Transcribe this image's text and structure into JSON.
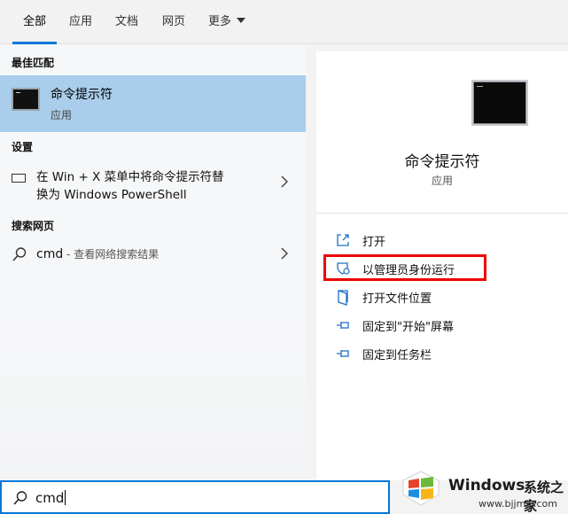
{
  "tabs": [
    {
      "label": "全部"
    },
    {
      "label": "应用"
    },
    {
      "label": "文档"
    },
    {
      "label": "网页"
    },
    {
      "label": "更多"
    }
  ],
  "sections": {
    "best_match": "最佳匹配",
    "settings": "设置",
    "web": "搜索网页"
  },
  "best_match": {
    "title": "命令提示符",
    "subtitle": "应用"
  },
  "settings_item": {
    "line1": "在 Win + X 菜单中将命令提示符替",
    "line2": "换为 Windows PowerShell"
  },
  "web_item": {
    "query": "cmd",
    "hint": " - 查看网络搜索结果"
  },
  "preview": {
    "title": "命令提示符",
    "subtitle": "应用"
  },
  "actions": [
    {
      "label": "打开",
      "icon": "open-icon"
    },
    {
      "label": "以管理员身份运行",
      "icon": "shield-icon"
    },
    {
      "label": "打开文件位置",
      "icon": "file-location-icon"
    },
    {
      "label": "固定到\"开始\"屏幕",
      "icon": "pin-icon"
    },
    {
      "label": "固定到任务栏",
      "icon": "pin-icon"
    }
  ],
  "search": {
    "value": "cmd"
  },
  "watermark": {
    "brand": "Windows",
    "brand_cn": "系统之家",
    "url": "www.bjjmlv.com"
  },
  "colors": {
    "accent": "#0078d7",
    "selected_row": "#a9cdea",
    "highlight_box": "#e00000"
  }
}
